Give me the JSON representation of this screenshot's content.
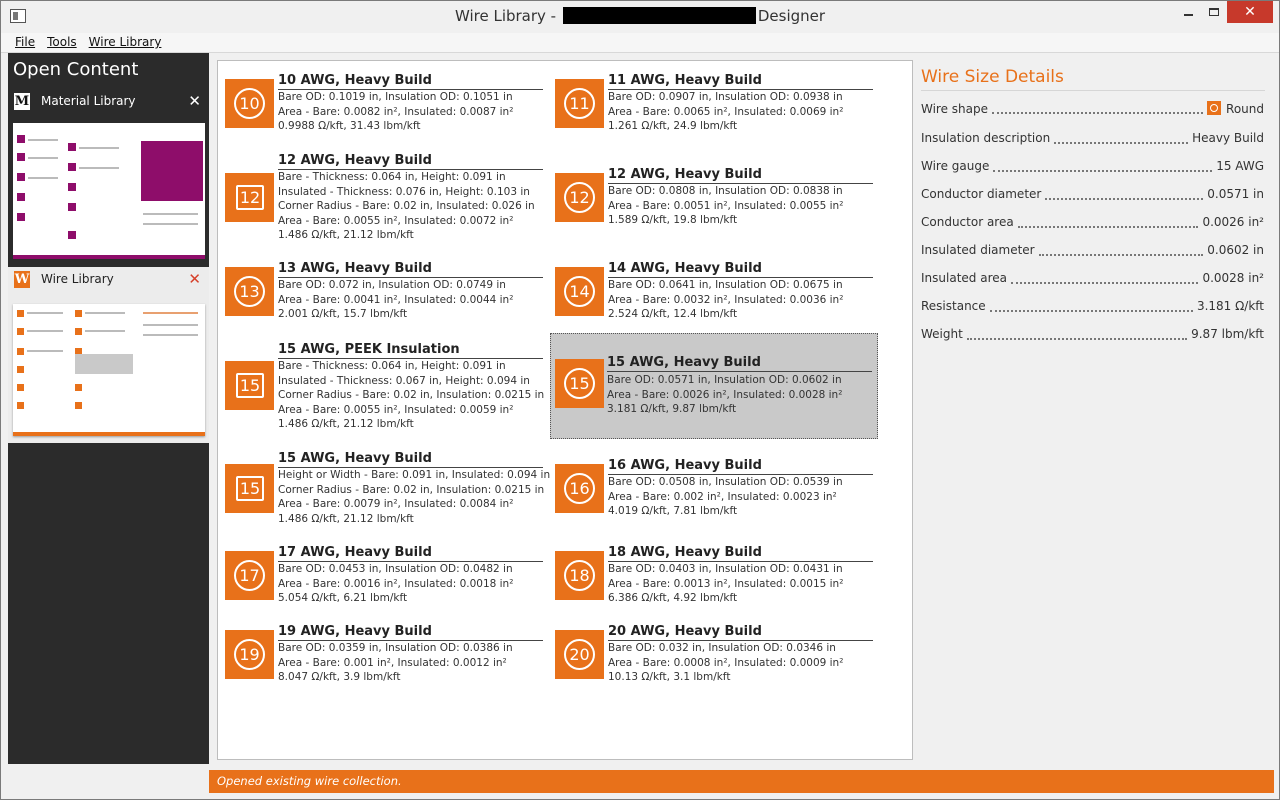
{
  "window": {
    "title_prefix": "Wire Library - ",
    "title_suffix": "Designer",
    "minimize": "—",
    "close": "✕"
  },
  "menu": {
    "file": "File",
    "tools": "Tools",
    "wire_library": "Wire Library"
  },
  "sidebar": {
    "title": "Open Content",
    "documents": [
      {
        "label": "Material Library",
        "icon": "M",
        "close": "✕"
      },
      {
        "label": "Wire Library",
        "icon": "W",
        "close": "✕"
      }
    ]
  },
  "wires": [
    {
      "number": "10",
      "shape": "round",
      "name": "10 AWG, Heavy Build",
      "lines": [
        "Bare OD: 0.1019 in, Insulation OD: 0.1051 in",
        "Area - Bare: 0.0082 in², Insulated: 0.0087 in²",
        "0.9988 Ω/kft, 31.43 lbm/kft"
      ]
    },
    {
      "number": "11",
      "shape": "round",
      "name": "11 AWG, Heavy Build",
      "lines": [
        "Bare OD: 0.0907 in, Insulation OD: 0.0938 in",
        "Area - Bare: 0.0065 in², Insulated: 0.0069 in²",
        "1.261 Ω/kft, 24.9 lbm/kft"
      ]
    },
    {
      "number": "12",
      "shape": "rect",
      "name": "12 AWG, Heavy Build",
      "lines": [
        "Bare - Thickness: 0.064 in, Height: 0.091 in",
        "Insulated - Thickness: 0.076 in, Height: 0.103 in",
        "Corner Radius - Bare: 0.02 in, Insulated: 0.026 in",
        "Area - Bare: 0.0055 in², Insulated: 0.0072 in²",
        "1.486 Ω/kft, 21.12 lbm/kft"
      ]
    },
    {
      "number": "12",
      "shape": "round",
      "name": "12 AWG, Heavy Build",
      "lines": [
        "Bare OD: 0.0808 in, Insulation OD: 0.0838 in",
        "Area - Bare: 0.0051 in², Insulated: 0.0055 in²",
        "1.589 Ω/kft, 19.8 lbm/kft"
      ]
    },
    {
      "number": "13",
      "shape": "round",
      "name": "13 AWG, Heavy Build",
      "lines": [
        "Bare OD: 0.072 in, Insulation OD: 0.0749 in",
        "Area - Bare: 0.0041 in², Insulated: 0.0044 in²",
        "2.001 Ω/kft, 15.7 lbm/kft"
      ]
    },
    {
      "number": "14",
      "shape": "round",
      "name": "14 AWG, Heavy Build",
      "lines": [
        "Bare OD: 0.0641 in, Insulation OD: 0.0675 in",
        "Area - Bare: 0.0032 in², Insulated: 0.0036 in²",
        "2.524 Ω/kft, 12.4 lbm/kft"
      ]
    },
    {
      "number": "15",
      "shape": "rect",
      "name": "15 AWG, PEEK Insulation",
      "lines": [
        "Bare - Thickness: 0.064 in, Height: 0.091 in",
        "Insulated - Thickness: 0.067 in, Height: 0.094 in",
        "Corner Radius - Bare: 0.02 in, Insulation: 0.0215 in",
        "Area - Bare: 0.0055 in², Insulated: 0.0059 in²",
        "1.486 Ω/kft, 21.12 lbm/kft"
      ]
    },
    {
      "number": "15",
      "shape": "round",
      "name": "15 AWG, Heavy Build",
      "selected": true,
      "lines": [
        "Bare OD: 0.0571 in, Insulation OD: 0.0602 in",
        "Area - Bare: 0.0026 in², Insulated: 0.0028 in²",
        "3.181 Ω/kft, 9.87 lbm/kft"
      ]
    },
    {
      "number": "15",
      "shape": "rect",
      "name": "15 AWG, Heavy Build",
      "lines": [
        "Height or Width - Bare: 0.091 in, Insulated: 0.094 in",
        "Corner Radius - Bare: 0.02 in, Insulation: 0.0215 in",
        "Area - Bare: 0.0079 in², Insulated: 0.0084 in²",
        "1.486 Ω/kft, 21.12 lbm/kft"
      ]
    },
    {
      "number": "16",
      "shape": "round",
      "name": "16 AWG, Heavy Build",
      "lines": [
        "Bare OD: 0.0508 in, Insulation OD: 0.0539 in",
        "Area - Bare: 0.002 in², Insulated: 0.0023 in²",
        "4.019 Ω/kft, 7.81 lbm/kft"
      ]
    },
    {
      "number": "17",
      "shape": "round",
      "name": "17 AWG, Heavy Build",
      "lines": [
        "Bare OD: 0.0453 in, Insulation OD: 0.0482 in",
        "Area - Bare: 0.0016 in², Insulated: 0.0018 in²",
        "5.054 Ω/kft, 6.21 lbm/kft"
      ]
    },
    {
      "number": "18",
      "shape": "round",
      "name": "18 AWG, Heavy Build",
      "lines": [
        "Bare OD: 0.0403 in, Insulation OD: 0.0431 in",
        "Area - Bare: 0.0013 in², Insulated: 0.0015 in²",
        "6.386 Ω/kft, 4.92 lbm/kft"
      ]
    },
    {
      "number": "19",
      "shape": "round",
      "name": "19 AWG, Heavy Build",
      "lines": [
        "Bare OD: 0.0359 in, Insulation OD: 0.0386 in",
        "Area - Bare: 0.001 in², Insulated: 0.0012 in²",
        "8.047 Ω/kft, 3.9 lbm/kft"
      ]
    },
    {
      "number": "20",
      "shape": "round",
      "name": "20 AWG, Heavy Build",
      "lines": [
        "Bare OD: 0.032 in, Insulation OD: 0.0346 in",
        "Area - Bare: 0.0008 in², Insulated: 0.0009 in²",
        "10.13 Ω/kft, 3.1 lbm/kft"
      ]
    }
  ],
  "details": {
    "title": "Wire Size Details",
    "rows": [
      {
        "label": "Wire shape",
        "value": "Round",
        "icon": "round-shape-icon"
      },
      {
        "label": "Insulation description",
        "value": "Heavy Build"
      },
      {
        "label": "Wire gauge",
        "value": "15 AWG"
      },
      {
        "label": "Conductor diameter",
        "value": "0.0571 in"
      },
      {
        "label": "Conductor area",
        "value": "0.0026 in²"
      },
      {
        "label": "Insulated diameter",
        "value": "0.0602 in"
      },
      {
        "label": "Insulated area",
        "value": "0.0028 in²"
      },
      {
        "label": "Resistance",
        "value": "3.181 Ω/kft"
      },
      {
        "label": "Weight",
        "value": "9.87 lbm/kft"
      }
    ]
  },
  "status": {
    "message": "Opened existing wire collection."
  },
  "colors": {
    "accent": "#e8711a",
    "material_accent": "#8e0d6a",
    "sidebar_bg": "#2b2b2b",
    "close_red": "#c7392b"
  }
}
